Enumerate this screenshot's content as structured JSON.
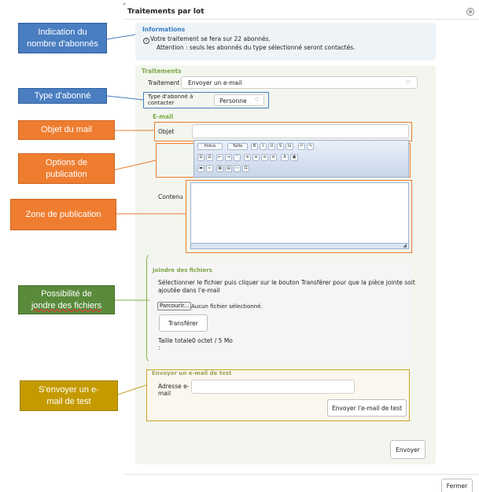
{
  "dialog": {
    "title": "Traitements par lot",
    "close_label": "⊗",
    "close_button_label": "Fermer"
  },
  "info": {
    "title": "Informations",
    "line1": "Votre traitement se fera sur 22 abonnés.",
    "line2": "Attention : seuls les abonnés du type sélectionné seront contactés."
  },
  "traitements": {
    "title": "Traitements",
    "traitement_label": "Traitement",
    "traitement_value": "Envoyer un e-mail",
    "type_label_1": "Type d'abonné à",
    "type_label_2": "contacter",
    "type_value": "Personne"
  },
  "email": {
    "title": "E-mail",
    "objet_label": "Objet",
    "contenu_label": "Contenu",
    "toolbar": {
      "row1": [
        "Police",
        "Taille",
        "B",
        "I",
        "U",
        "S",
        "Ix",
        "↶",
        "↷"
      ],
      "row2": [
        "☰",
        "☰",
        "⇤",
        "⇥",
        "”",
        "≡",
        "≡",
        "≡",
        "≡",
        "A",
        "▣"
      ],
      "row3": [
        "▬",
        "≈",
        "▦",
        "▤",
        "—",
        "Ω"
      ]
    }
  },
  "attachments": {
    "title": "Joindre des fichiers",
    "desc1": "Sélectionner le fichier puis cliquer sur le bouton Transférer pour que la pièce jointe soit",
    "desc2": "ajoutée dans l'e-mail",
    "browse_label": "Parcourir...",
    "no_file": "Aucun fichier sélectionné.",
    "transfer_label": "Transférer",
    "total_label_1": "Taille totale",
    "total_label_2": ":",
    "total_value": "0 octet / 5 Mo"
  },
  "test_email": {
    "title": "Envoyer un e-mail de test",
    "address_label_1": "Adresse e-",
    "address_label_2": "mail",
    "send_test_label": "Envoyer l'e-mail de test"
  },
  "send_label": "Envoyer",
  "annotations": {
    "nb_abonnes": [
      "Indication du",
      "nombre d'abonnés"
    ],
    "type_abonne": "Type d'abonné",
    "objet": "Objet du mail",
    "options": [
      "Options de",
      "publication"
    ],
    "zone": "Zone de publication",
    "fichiers": [
      "Possibilité de",
      "jondre des fichiers"
    ],
    "test": [
      "S'envoyer un e-",
      "mail de test"
    ]
  }
}
